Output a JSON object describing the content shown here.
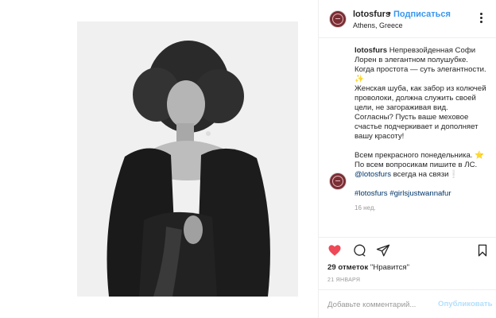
{
  "post": {
    "username": "lotosfurs",
    "separator": "•",
    "follow_label": "Подписаться",
    "location": "Athens, Greece",
    "image_alt": "Black and white portrait of a woman with voluminous hair wearing a dark fur coat"
  },
  "caption": {
    "username": "lotosfurs",
    "lines": [
      "Непревзойденная Софи Лорен в элегантном полушубке. Когда простота — суть элегантности. ✨",
      "Женская шуба, как забор из колючей проволоки, должна служить своей цели, не загораживая вид. Согласны? Пусть ваше меховое счастье подчеркивает и дополняет вашу красоту!"
    ],
    "monday": "Всем прекрасного понедельника.",
    "monday_emoji": "⭐",
    "contact_prefix": "По всем вопросикам пишите в ЛС.",
    "contact_mention": "@lotosfurs",
    "contact_suffix": " всегда на связи❕",
    "hashtags": "#lotosfurs #girlsjustwannafur",
    "time": "16 нед."
  },
  "engagement": {
    "likes_count": "29 отметок",
    "likes_suffix": " \"Нравится\"",
    "date": "21 ЯНВАРЯ"
  },
  "comment_box": {
    "placeholder": "Добавьте комментарий...",
    "publish_label": "Опубликовать"
  },
  "colors": {
    "like_red": "#ed4956",
    "link_blue": "#3897f0",
    "publish_disabled": "#b2dffc",
    "avatar_brand": "#7a2e34"
  },
  "icons": {
    "like": "heart-icon",
    "comment": "comment-icon",
    "share": "share-icon",
    "save": "bookmark-icon",
    "more": "more-options-icon"
  }
}
